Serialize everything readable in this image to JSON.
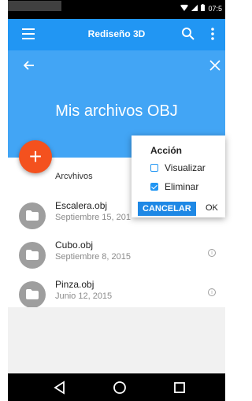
{
  "status_bar": {
    "time": "07:5"
  },
  "app_bar": {
    "title": "Rediseño 3D"
  },
  "header": {
    "title": "Mis archivos OBJ"
  },
  "fab": {
    "label": "+"
  },
  "section": {
    "title": "Arcvhivos"
  },
  "files": [
    {
      "name": "Escalera.obj",
      "date": "Septiembre 15, 201"
    },
    {
      "name": "Cubo.obj",
      "date": "Septiembre 8, 2015"
    },
    {
      "name": "Pinza.obj",
      "date": "Junio 12, 2015"
    }
  ],
  "popup": {
    "title": "Acción",
    "options": [
      {
        "label": "Visualizar",
        "checked": false
      },
      {
        "label": "Eliminar",
        "checked": true
      }
    ],
    "cancel_label": "CANCELAR",
    "ok_label": "OK"
  },
  "colors": {
    "primary": "#2196F3",
    "header": "#42A5F5",
    "fab": "#F4511E"
  },
  "icons": [
    "menu-icon",
    "search-icon",
    "more-vert-icon",
    "back-arrow-icon",
    "close-icon",
    "folder-icon",
    "info-icon",
    "nav-back-icon",
    "nav-home-icon",
    "nav-recents-icon"
  ]
}
